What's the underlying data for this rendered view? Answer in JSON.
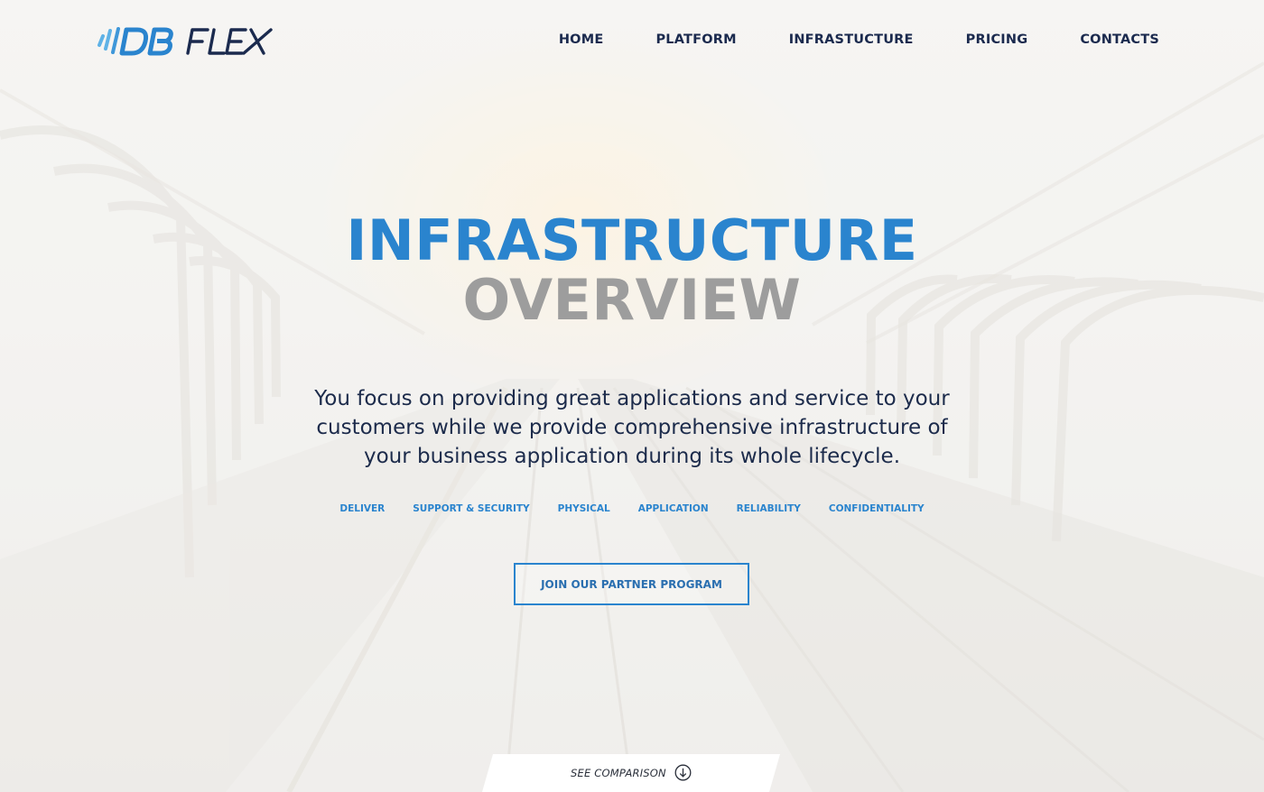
{
  "brand": {
    "logo_text": "DB FLEX",
    "logo_left": "DB",
    "logo_right": "FLEX",
    "accent_color": "#2a84ce",
    "dark_color": "#1b2a4e"
  },
  "nav": {
    "items": [
      {
        "label": "HOME"
      },
      {
        "label": "PLATFORM"
      },
      {
        "label": "INFRASTUCTURE"
      },
      {
        "label": "PRICING"
      },
      {
        "label": "CONTACTS"
      }
    ]
  },
  "hero": {
    "title": "INFRASTRUCTURE",
    "subtitle": "OVERVIEW",
    "description": "You focus on providing great applications and service to your customers while we provide comprehensive infrastructure of your business application during its whole lifecycle.",
    "tags": [
      {
        "label": "DELIVER"
      },
      {
        "label": "SUPPORT & SECURITY"
      },
      {
        "label": "PHYSICAL"
      },
      {
        "label": "APPLICATION"
      },
      {
        "label": "RELIABILITY"
      },
      {
        "label": "CONFIDENTIALITY"
      }
    ],
    "cta_label": "JOIN OUR PARTNER PROGRAM"
  },
  "footer_tab": {
    "label": "SEE COMPARISON",
    "icon": "arrow-down-circle-icon"
  }
}
